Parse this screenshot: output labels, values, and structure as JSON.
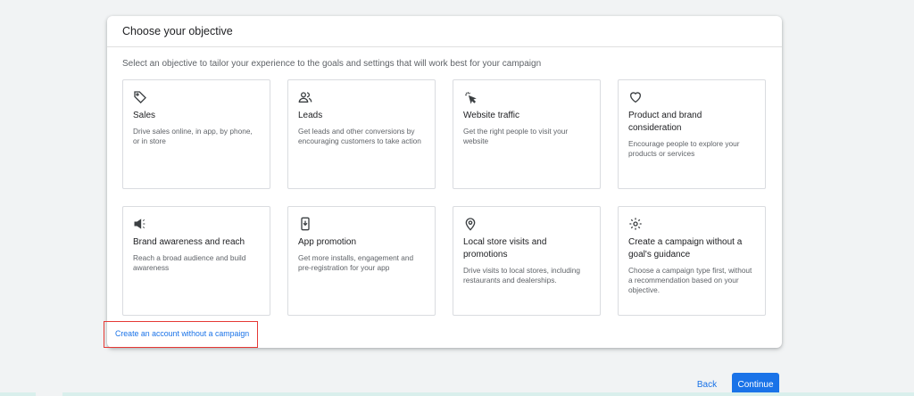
{
  "dialog": {
    "title": "Choose your objective",
    "subtitle": "Select an objective to tailor your experience to the goals and settings that will work best for your campaign"
  },
  "objectives": [
    {
      "icon": "tag-icon",
      "title": "Sales",
      "description": "Drive sales online, in app, by phone, or in store"
    },
    {
      "icon": "people-icon",
      "title": "Leads",
      "description": "Get leads and other conversions by encouraging customers to take action"
    },
    {
      "icon": "cursor-click-icon",
      "title": "Website traffic",
      "description": "Get the right people to visit your website"
    },
    {
      "icon": "heart-icon",
      "title": "Product and brand consideration",
      "description": "Encourage people to explore your products or services"
    },
    {
      "icon": "megaphone-icon",
      "title": "Brand awareness and reach",
      "description": "Reach a broad audience and build awareness"
    },
    {
      "icon": "mobile-download-icon",
      "title": "App promotion",
      "description": "Get more installs, engagement and pre-registration for your app"
    },
    {
      "icon": "location-pin-icon",
      "title": "Local store visits and promotions",
      "description": "Drive visits to local stores, including restaurants and dealerships."
    },
    {
      "icon": "gear-icon",
      "title": "Create a campaign without a goal's guidance",
      "description": "Choose a campaign type first, without a recommendation based on your objective."
    }
  ],
  "links": {
    "create_account": "Create an account without a campaign"
  },
  "footer": {
    "back_label": "Back",
    "continue_label": "Continue"
  },
  "colors": {
    "accent": "#1a73e8",
    "highlight": "#e53935"
  }
}
